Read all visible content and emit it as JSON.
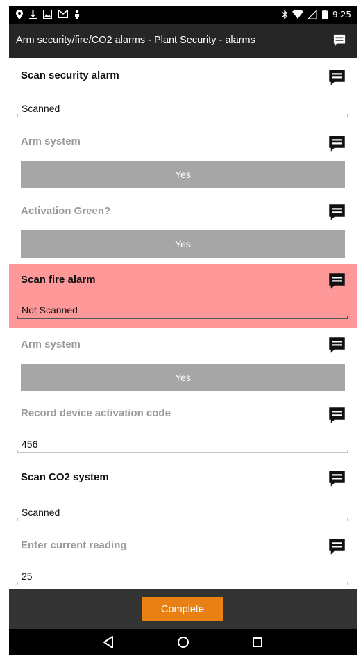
{
  "status_bar": {
    "left_icons": [
      "location-icon",
      "download-icon",
      "image-icon",
      "gmail-icon",
      "figure-icon"
    ],
    "time": "9:25",
    "right_icons": [
      "bluetooth-icon",
      "wifi-icon",
      "signal-icon",
      "battery-icon"
    ]
  },
  "header": {
    "title": "Arm security/fire/CO2 alarms - Plant Security - alarms",
    "comment_icon": "comment-icon"
  },
  "items": [
    {
      "label": "Scan security alarm",
      "type": "text",
      "value": "Scanned",
      "state": "active"
    },
    {
      "label": "Arm system",
      "type": "button",
      "value": "Yes",
      "state": "inactive"
    },
    {
      "label": "Activation Green?",
      "type": "button",
      "value": "Yes",
      "state": "inactive"
    },
    {
      "label": "Scan fire alarm",
      "type": "text",
      "value": "Not Scanned",
      "state": "alert"
    },
    {
      "label": "Arm system",
      "type": "button",
      "value": "Yes",
      "state": "inactive"
    },
    {
      "label": "Record device activation code",
      "type": "text",
      "value": "456",
      "state": "inactive"
    },
    {
      "label": "Scan CO2 system",
      "type": "text",
      "value": "Scanned",
      "state": "active"
    },
    {
      "label": "Enter current reading",
      "type": "text",
      "value": "25",
      "state": "inactive"
    }
  ],
  "colors": {
    "alert_background": "#ff9999",
    "button_gray": "#a6a6a6",
    "complete_orange": "#e88013",
    "header_dark": "#262626"
  },
  "footer": {
    "complete_label": "Complete"
  },
  "nav": {
    "back_icon": "back-triangle-icon",
    "home_icon": "home-circle-icon",
    "recents_icon": "recents-square-icon"
  }
}
